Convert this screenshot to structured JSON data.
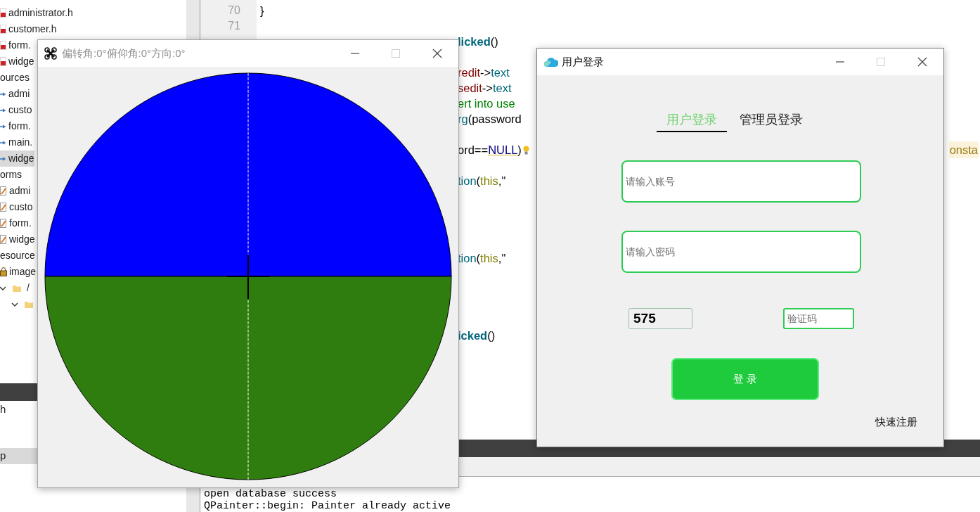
{
  "project_tree": {
    "files": [
      {
        "label": "administrator.h",
        "kind": "header",
        "selected": false
      },
      {
        "label": "customer.h",
        "kind": "header",
        "selected": false
      },
      {
        "label": "form.",
        "kind": "header",
        "selected": false
      },
      {
        "label": "widge",
        "kind": "header",
        "selected": false
      }
    ],
    "groups": [
      {
        "label": "ources",
        "children": [
          {
            "label": "admi",
            "kind": "source",
            "selected": false
          },
          {
            "label": "custo",
            "kind": "source",
            "selected": false
          },
          {
            "label": "form.",
            "kind": "source",
            "selected": false
          },
          {
            "label": "main.",
            "kind": "source",
            "selected": false
          },
          {
            "label": "widge",
            "kind": "source",
            "selected": true
          }
        ]
      },
      {
        "label": "orms",
        "children": [
          {
            "label": "admi",
            "kind": "form",
            "selected": false
          },
          {
            "label": "custo",
            "kind": "form",
            "selected": false
          },
          {
            "label": "form.",
            "kind": "form",
            "selected": false
          },
          {
            "label": "widge",
            "kind": "form",
            "selected": false
          }
        ]
      },
      {
        "label": "esource",
        "children": [
          {
            "label": "image",
            "kind": "resource",
            "selected": false,
            "children": [
              {
                "label": "/",
                "kind": "folder",
                "expanded": true,
                "selected": false,
                "children": [
                  {
                    "kind": "folder",
                    "expanded": true,
                    "selected": false
                  }
                ]
              }
            ]
          }
        ]
      }
    ]
  },
  "lower_panel": {
    "items": [
      {
        "label": "h",
        "selected": false
      },
      {
        "label": "p",
        "selected": true
      }
    ]
  },
  "editor": {
    "lines": [
      {
        "kind": "numbered",
        "number": "70",
        "tokens": [
          {
            "kind": "plain",
            "text": "}"
          }
        ]
      },
      {
        "kind": "numbered",
        "number": "71"
      },
      {
        "kind": "fragment",
        "tokens": [
          {
            "kind": "method_bold",
            "text": "licked"
          },
          {
            "kind": "plain",
            "text": "()"
          }
        ]
      },
      {
        "kind": "blank"
      },
      {
        "kind": "fragment",
        "tokens": [
          {
            "kind": "member",
            "text": "redit"
          },
          {
            "kind": "plain",
            "text": "->"
          },
          {
            "kind": "method",
            "text": "text"
          }
        ]
      },
      {
        "kind": "fragment",
        "tokens": [
          {
            "kind": "member",
            "text": "sedit"
          },
          {
            "kind": "plain",
            "text": "->"
          },
          {
            "kind": "method",
            "text": "text"
          }
        ]
      },
      {
        "kind": "fragment",
        "tokens": [
          {
            "kind": "string",
            "text": "ert into use"
          }
        ]
      },
      {
        "kind": "fragment",
        "tokens": [
          {
            "kind": "method",
            "text": "rg"
          },
          {
            "kind": "plain",
            "text": "(password"
          }
        ]
      },
      {
        "kind": "blank"
      },
      {
        "kind": "fragment",
        "bulb": true,
        "hint": "onsta",
        "tokens": [
          {
            "kind": "plain",
            "text": "ord=="
          },
          {
            "kind": "macro",
            "text": "NULL"
          },
          {
            "kind": "plain",
            "text": ")"
          }
        ]
      },
      {
        "kind": "blank"
      },
      {
        "kind": "fragment",
        "tokens": [
          {
            "kind": "method",
            "text": "tion"
          },
          {
            "kind": "plain",
            "text": "("
          },
          {
            "kind": "keyword",
            "text": "this"
          },
          {
            "kind": "plain",
            "text": ",\""
          }
        ]
      },
      {
        "kind": "blank"
      },
      {
        "kind": "blank"
      },
      {
        "kind": "blank"
      },
      {
        "kind": "blank"
      },
      {
        "kind": "fragment",
        "tokens": [
          {
            "kind": "method",
            "text": "tion"
          },
          {
            "kind": "plain",
            "text": "("
          },
          {
            "kind": "keyword",
            "text": "this"
          },
          {
            "kind": "plain",
            "text": ",\""
          }
        ]
      },
      {
        "kind": "blank"
      },
      {
        "kind": "blank"
      },
      {
        "kind": "blank"
      },
      {
        "kind": "blank"
      },
      {
        "kind": "fragment",
        "tokens": [
          {
            "kind": "method_bold",
            "text": "icked"
          },
          {
            "kind": "plain",
            "text": "()"
          }
        ]
      }
    ]
  },
  "output": {
    "lines": [
      "open database success",
      "QPainter::begin: Painter already active"
    ]
  },
  "attitude_window": {
    "title": "偏转角:0°俯仰角:0°方向:0°",
    "maximize_enabled": false
  },
  "login_window": {
    "title": "用户登录",
    "maximize_enabled": false,
    "tabs": [
      {
        "label": "用户登录",
        "selected": true
      },
      {
        "label": "管理员登录",
        "selected": false
      }
    ],
    "account_field": {
      "placeholder": "请输入账号"
    },
    "password_field": {
      "placeholder": "请输入密码"
    },
    "captcha": {
      "code": "575"
    },
    "captcha_field": {
      "placeholder": "验证码"
    },
    "login_button": "登 录",
    "register_link": "快速注册"
  }
}
